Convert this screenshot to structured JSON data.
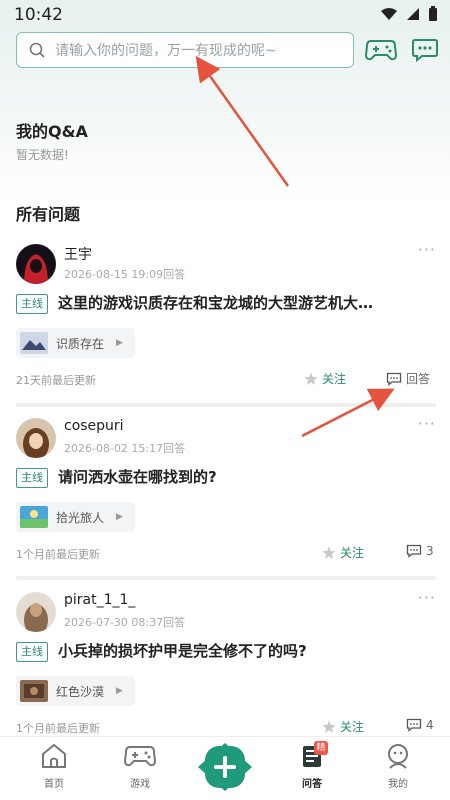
{
  "status_bar": {
    "time": "10:42"
  },
  "search": {
    "placeholder": "请输入你的问题，万一有现成的呢~"
  },
  "my_qa": {
    "title": "我的Q&A",
    "empty": "暂无数据!"
  },
  "all_questions": {
    "title": "所有问题"
  },
  "questions": [
    {
      "author": "王宇",
      "meta": "2026-08-15 19:09回答",
      "tag": "主线",
      "title": "这里的游戏识质存在和宝龙城的大型游艺机大…",
      "game": "识质存在",
      "updated": "21天前最后更新",
      "follow": "关注",
      "answer": "回答"
    },
    {
      "author": "cosepuri",
      "meta": "2026-08-02 15:17回答",
      "tag": "主线",
      "title": "请问洒水壶在哪找到的?",
      "game": "拾光旅人",
      "updated": "1个月前最后更新",
      "follow": "关注",
      "answer": "3"
    },
    {
      "author": "pirat_1_1_",
      "meta": "2026-07-30 08:37回答",
      "tag": "主线",
      "title": "小兵掉的损坏护甲是完全修不了的吗?",
      "game": "红色沙漠",
      "updated": "1个月前最后更新",
      "follow": "关注",
      "answer": "4"
    }
  ],
  "more": "···",
  "nav": {
    "home": "首页",
    "games": "游戏",
    "qa": "问答",
    "qa_badge": "精",
    "me": "我的"
  },
  "colors": {
    "accent": "#2c8a71",
    "annotation": "#e5533d",
    "plus_bg": "#1f9a7a"
  }
}
